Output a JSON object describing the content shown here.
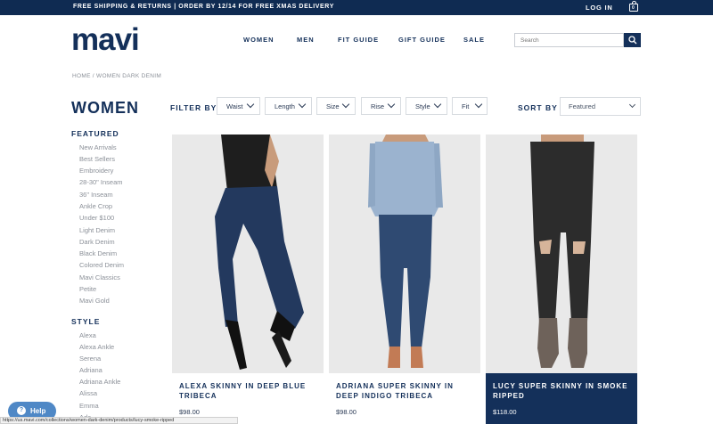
{
  "promo": {
    "text": "FREE SHIPPING & RETURNS | ORDER BY 12/14 FOR FREE XMAS DELIVERY",
    "login": "LOG IN",
    "bag_count": "0"
  },
  "logo": "mavi",
  "nav": [
    "WOMEN",
    "MEN",
    "FIT GUIDE",
    "GIFT GUIDE",
    "SALE"
  ],
  "search": {
    "placeholder": "Search",
    "icon": "search-icon"
  },
  "breadcrumb": "HOME / WOMEN DARK DENIM",
  "page_title": "WOMEN",
  "filter": {
    "label": "FILTER BY",
    "options": [
      "Waist",
      "Length",
      "Size",
      "Rise",
      "Style",
      "Fit"
    ]
  },
  "sort": {
    "label": "SORT BY",
    "value": "Featured"
  },
  "sidebar": {
    "featured_heading": "FEATURED",
    "featured": [
      "New Arrivals",
      "Best Sellers",
      "Embroidery",
      "28-30\" Inseam",
      "36\" Inseam",
      "Ankle Crop",
      "Under $100",
      "Light Denim",
      "Dark Denim",
      "Black Denim",
      "Colored Denim",
      "Mavi Classics",
      "Petite",
      "Mavi Gold"
    ],
    "style_heading": "STYLE",
    "style": [
      "Alexa",
      "Alexa Ankle",
      "Serena",
      "Adriana",
      "Adriana Ankle",
      "Alissa",
      "Emma",
      "Ada"
    ]
  },
  "products": [
    {
      "name": "ALEXA SKINNY IN DEEP BLUE TRIBECA",
      "price": "$98.00"
    },
    {
      "name": "ADRIANA SUPER SKINNY IN DEEP INDIGO TRIBECA",
      "price": "$98.00"
    },
    {
      "name": "LUCY SUPER SKINNY IN SMOKE RIPPED",
      "price": "$118.00"
    }
  ],
  "help": {
    "label": "Help",
    "icon": "question-icon"
  },
  "status_url": "https://us.mavi.com/collections/women-dark-denim/products/lucy-smoke-ripped",
  "colors": {
    "brand_navy": "#14305a",
    "promo_bar": "#0f2b52",
    "help_blue": "#4f88c6"
  }
}
